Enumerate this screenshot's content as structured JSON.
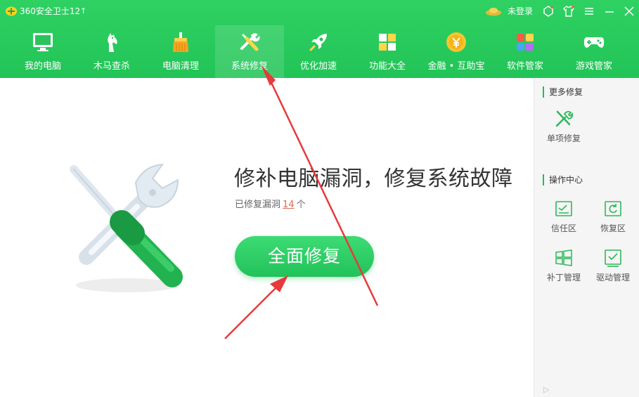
{
  "titlebar": {
    "app_title": "360安全卫士12",
    "update_arrow": "↑",
    "login_text": "未登录",
    "icons": [
      "skin-icon",
      "shirt-icon",
      "menu-icon",
      "minimize-icon",
      "close-icon"
    ]
  },
  "nav": {
    "items": [
      {
        "label": "我的电脑",
        "icon": "computer-icon"
      },
      {
        "label": "木马查杀",
        "icon": "horse-icon"
      },
      {
        "label": "电脑清理",
        "icon": "broom-icon"
      },
      {
        "label": "系统修复",
        "icon": "wrench-icon",
        "active": true
      },
      {
        "label": "优化加速",
        "icon": "rocket-icon"
      },
      {
        "label": "功能大全",
        "icon": "grid-icon"
      },
      {
        "label": "金融 • 互助宝",
        "icon": "coin-icon"
      },
      {
        "label": "软件管家",
        "icon": "apps-icon"
      },
      {
        "label": "游戏管家",
        "icon": "gamepad-icon"
      }
    ]
  },
  "main": {
    "headline": "修补电脑漏洞，修复系统故障",
    "sub_prefix": "已修复漏洞",
    "fixed_count": "14",
    "sub_suffix": "个",
    "fix_button": "全面修复"
  },
  "side": {
    "more_title": "更多修复",
    "single_fix": "单项修复",
    "ops_title": "操作中心",
    "trust_zone": "信任区",
    "restore_zone": "恢复区",
    "patch_manage": "补丁管理",
    "driver_manage": "驱动管理",
    "collapse": "▷"
  },
  "colors": {
    "brand_green": "#22c457",
    "accent_red": "#e8393c",
    "count_orange": "#e26a4a"
  }
}
